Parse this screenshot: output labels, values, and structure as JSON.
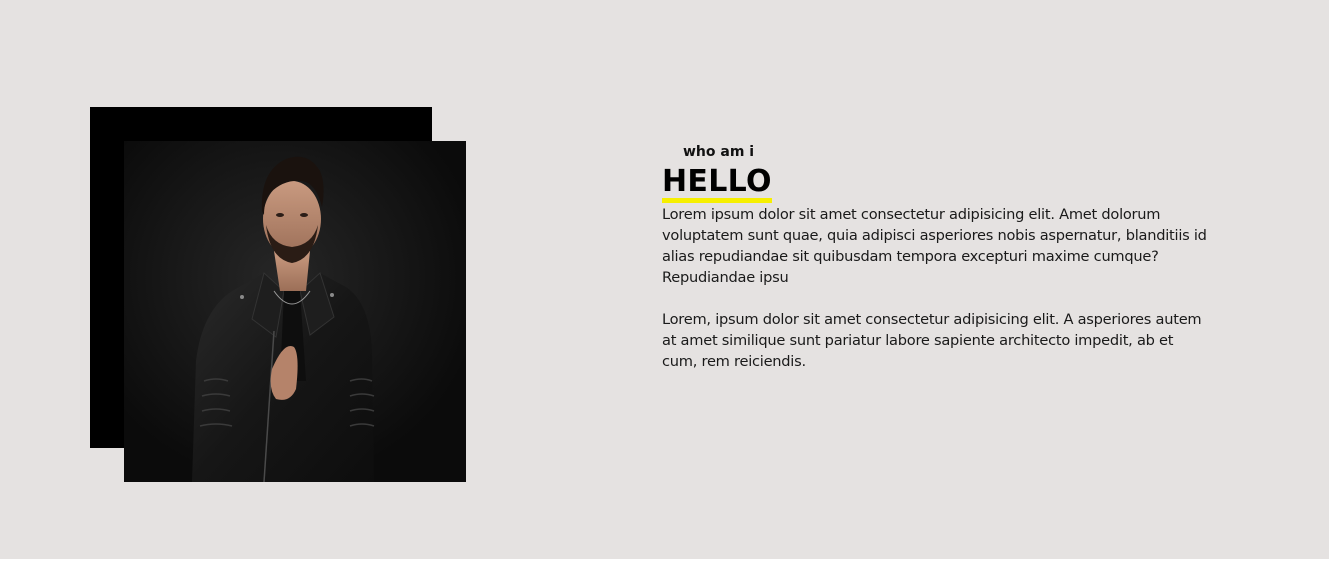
{
  "about": {
    "eyebrow": "who am i",
    "title": "HELLO",
    "paragraphs": [
      "Lorem ipsum dolor sit amet consectetur adipisicing elit. Amet dolorum voluptatem sunt quae, quia adipisci asperiores nobis aspernatur, blanditiis id alias repudiandae sit quibusdam tempora excepturi maxime cumque? Repudiandae ipsu",
      "Lorem, ipsum dolor sit amet consectetur adipisicing elit. A asperiores autem at amet similique sunt pariatur labore sapiente architecto impedit, ab et cum, rem reiciendis."
    ]
  },
  "colors": {
    "background": "#e5e2e1",
    "frame": "#000000",
    "underline": "#f6ef00"
  }
}
